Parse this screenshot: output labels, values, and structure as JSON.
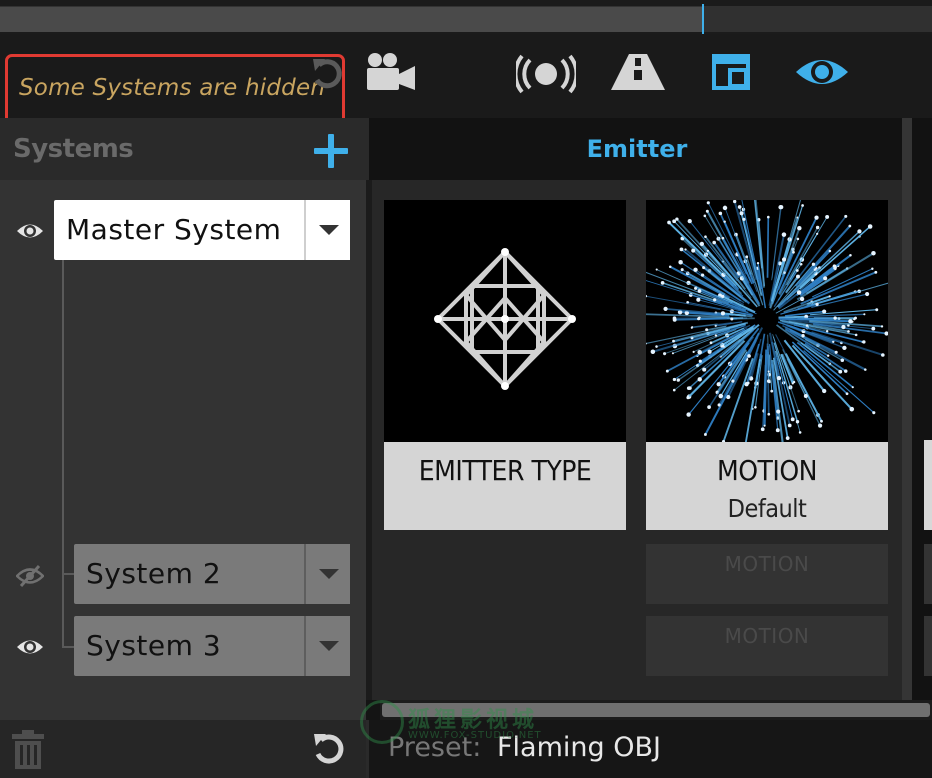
{
  "notice": {
    "text": "Some Systems are hidden",
    "border_color": "#e03a32",
    "text_color": "#c9a560"
  },
  "toolbar": {
    "icons": [
      "reset-icon",
      "camera-icon",
      "broadcast-icon",
      "road-icon",
      "window-icon",
      "eye-icon"
    ],
    "accent": "#3fb0ea"
  },
  "systems": {
    "title": "Systems",
    "items": [
      {
        "label": "Master System",
        "visible": true,
        "active": true
      },
      {
        "label": "System  2",
        "visible": false,
        "active": false
      },
      {
        "label": "System  3",
        "visible": true,
        "active": false
      }
    ]
  },
  "emitter": {
    "title": "Emitter",
    "modules": [
      {
        "title": "EMITTER TYPE",
        "subtitle": ""
      },
      {
        "title": "MOTION",
        "subtitle": "Default"
      }
    ],
    "empty_slots": [
      "MOTION",
      "MOTION"
    ]
  },
  "preset": {
    "label": "Preset:",
    "value": "Flaming OBJ"
  },
  "watermark": {
    "text": "狐狸影视城",
    "url": "WWW.FOX-STUDIO.NET"
  }
}
